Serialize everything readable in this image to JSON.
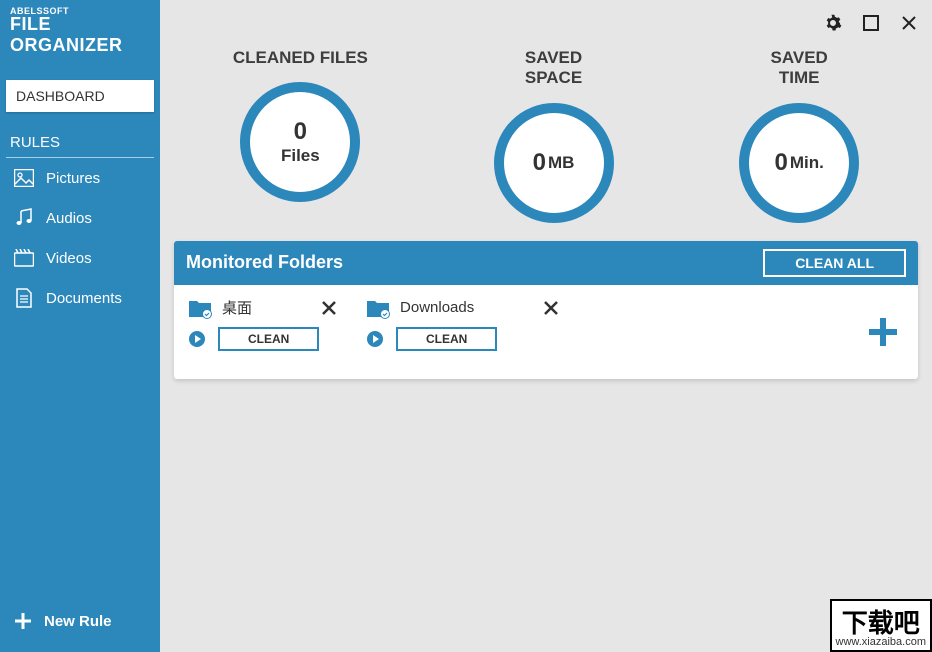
{
  "brand": {
    "top": "ABELSSOFT",
    "main": "FILE ORGANIZER"
  },
  "sidebar": {
    "dashboard": "DASHBOARD",
    "rules_header": "RULES",
    "items": [
      {
        "label": "Pictures"
      },
      {
        "label": "Audios"
      },
      {
        "label": "Videos"
      },
      {
        "label": "Documents"
      }
    ],
    "new_rule": "New Rule"
  },
  "stats": [
    {
      "title": "CLEANED FILES",
      "value": "0",
      "unit": "Files",
      "inline": false
    },
    {
      "title": "SAVED SPACE",
      "value": "0",
      "unit": "MB",
      "inline": true
    },
    {
      "title": "SAVED TIME",
      "value": "0",
      "unit": "Min.",
      "inline": true
    }
  ],
  "monitored": {
    "title": "Monitored Folders",
    "clean_all": "CLEAN ALL",
    "folders": [
      {
        "name": "桌面",
        "clean": "CLEAN"
      },
      {
        "name": "Downloads",
        "clean": "CLEAN"
      }
    ]
  },
  "watermark": {
    "top": "下载吧",
    "bottom": "www.xiazaiba.com"
  },
  "colors": {
    "primary": "#2c87bb",
    "bg": "#e6e6e6"
  }
}
